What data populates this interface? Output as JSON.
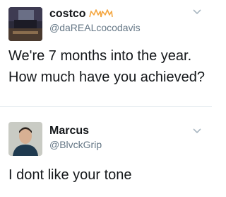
{
  "tweets": [
    {
      "display_name": "costco",
      "handle": "@daREALcocodavis",
      "lines": [
        "We're 7 months into the year.",
        "How much have you achieved?"
      ]
    },
    {
      "display_name": "Marcus",
      "handle": "@BlvckGrip",
      "lines": [
        "I dont like your tone"
      ]
    }
  ],
  "icons": {
    "crown": "crown-icon",
    "menu": "chevron-down-icon"
  },
  "colors": {
    "name": "#14171a",
    "handle": "#657786",
    "chevron": "#aab8c2",
    "crown": "#f4a742"
  }
}
